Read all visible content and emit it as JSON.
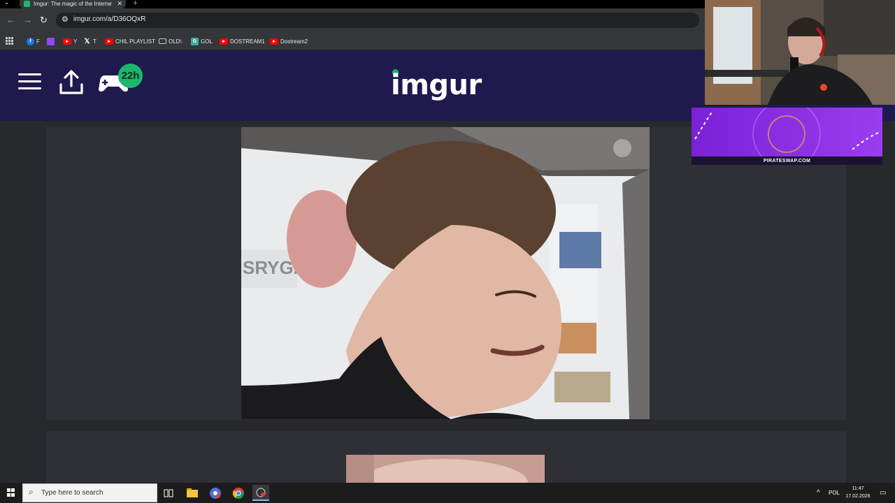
{
  "browser": {
    "tab": {
      "title": "Imgur: The magic of the Internet",
      "favicon": "imgur-favicon-icon"
    },
    "address_bar": {
      "url": "imgur.com/a/D36OQxR"
    },
    "bookmarks": [
      {
        "label": "F",
        "icon": "facebook-icon",
        "color": "#1877f2"
      },
      {
        "label": "",
        "icon": "twitch-icon",
        "color": "#9146ff"
      },
      {
        "label": "Y",
        "icon": "youtube-icon",
        "color": "#ff0000"
      },
      {
        "label": "T",
        "icon": "x-icon",
        "color": "#000000"
      },
      {
        "label": "CHIL PLAYLIST",
        "icon": "youtube-icon",
        "color": "#ff0000"
      },
      {
        "label": "OLD\\",
        "icon": "folder-icon",
        "color": "#c8c8c8"
      },
      {
        "label": "GOL",
        "icon": "gol-icon",
        "color": "#3fa9a0"
      },
      {
        "label": "DOSTREAM1",
        "icon": "youtube-icon",
        "color": "#ff0000"
      },
      {
        "label": "Dostream2",
        "icon": "youtube-icon",
        "color": "#ff0000"
      }
    ]
  },
  "imgur": {
    "logo": "imgur",
    "badge": "22h",
    "accent": "#1bb76e",
    "header_bg": "#1e1a4e"
  },
  "overlay": {
    "ad_text": "PIRATESWAP.COM"
  },
  "taskbar": {
    "search_placeholder": "Type here to search",
    "language": "POL",
    "time": "11:47",
    "date": "17.02.2026"
  }
}
